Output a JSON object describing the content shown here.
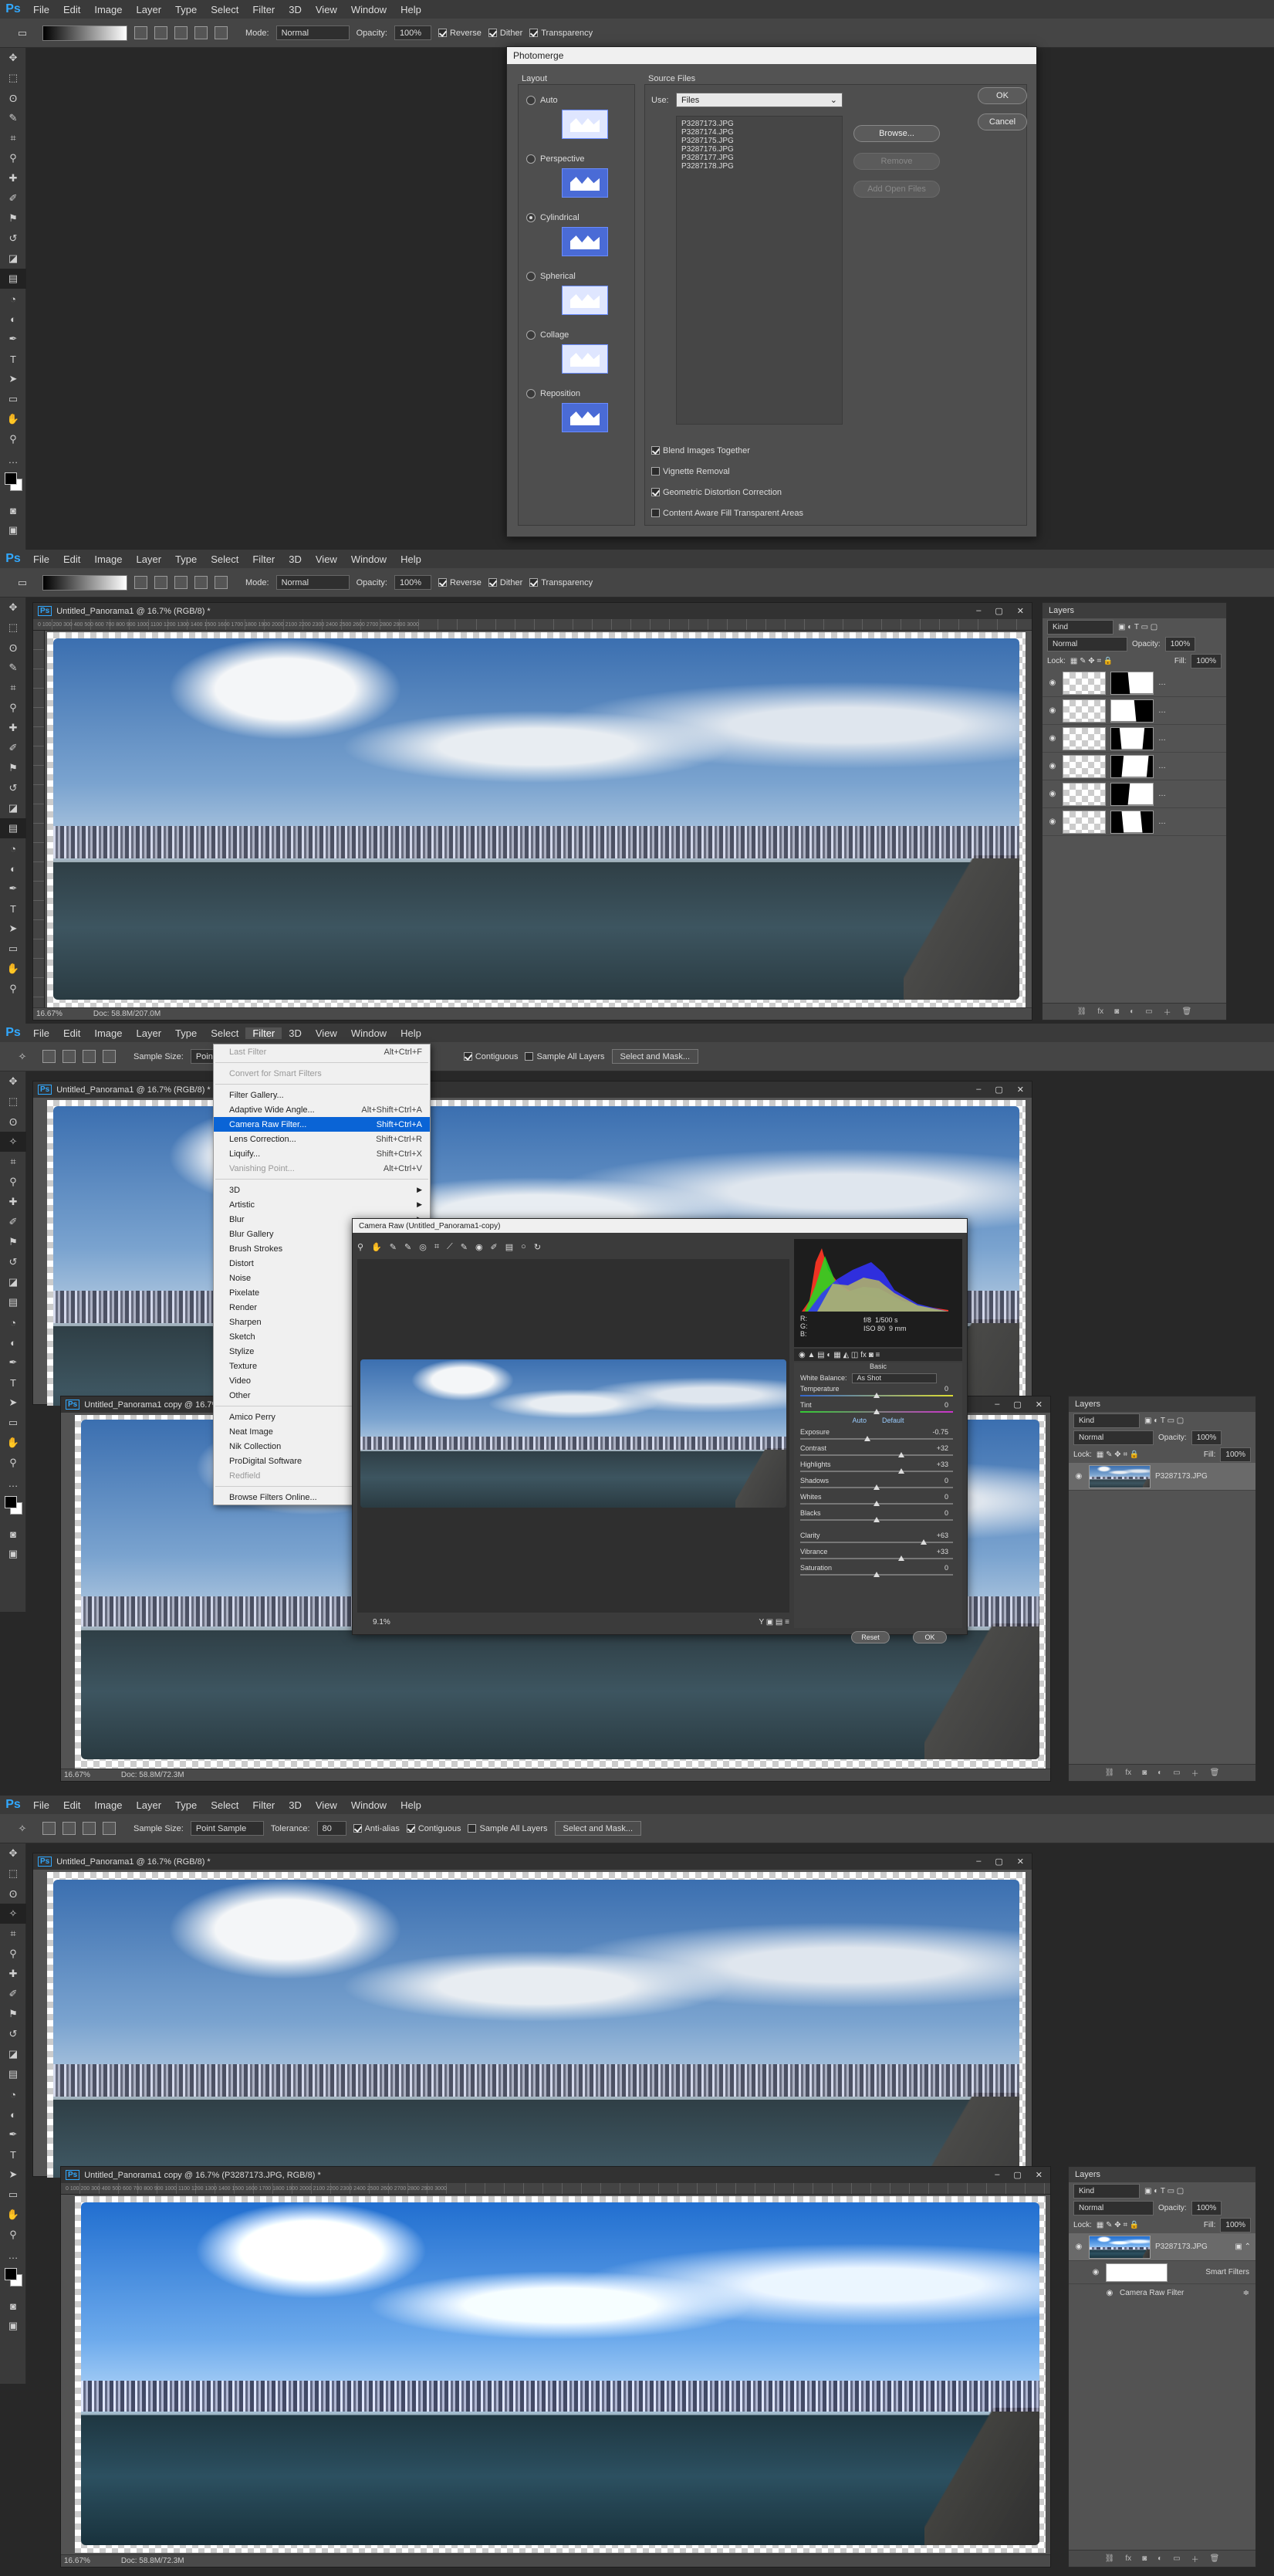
{
  "app": {
    "menus": [
      "File",
      "Edit",
      "Image",
      "Layer",
      "Type",
      "Select",
      "Filter",
      "3D",
      "View",
      "Window",
      "Help"
    ],
    "window_controls": [
      "–",
      "▢",
      "✕"
    ]
  },
  "gradient_options": {
    "mode_label": "Mode:",
    "mode_value": "Normal",
    "opacity_label": "Opacity:",
    "opacity_value": "100%",
    "reverse": "Reverse",
    "dither": "Dither",
    "transparency": "Transparency"
  },
  "wand_options": {
    "sample_size_label": "Sample Size:",
    "sample_size_value": "Point Sample",
    "tolerance_label": "Tolerance:",
    "tolerance_value": "80",
    "anti_alias": "Anti-alias",
    "contiguous": "Contiguous",
    "sample_all": "Sample All Layers",
    "select_mask": "Select and Mask..."
  },
  "photomerge": {
    "title": "Photomerge",
    "layout_label": "Layout",
    "layouts": [
      "Auto",
      "Perspective",
      "Cylindrical",
      "Spherical",
      "Collage",
      "Reposition"
    ],
    "selected_layout": "Cylindrical",
    "source_label": "Source Files",
    "use_label": "Use:",
    "use_value": "Files",
    "files": [
      "P3287173.JPG",
      "P3287174.JPG",
      "P3287175.JPG",
      "P3287176.JPG",
      "P3287177.JPG",
      "P3287178.JPG"
    ],
    "browse": "Browse...",
    "remove": "Remove",
    "add_open": "Add Open Files",
    "ok": "OK",
    "cancel": "Cancel",
    "options": [
      {
        "label": "Blend Images Together",
        "checked": true
      },
      {
        "label": "Vignette Removal",
        "checked": false
      },
      {
        "label": "Geometric Distortion Correction",
        "checked": true
      },
      {
        "label": "Content Aware Fill Transparent Areas",
        "checked": false
      }
    ]
  },
  "doc1": {
    "title": "Untitled_Panorama1 @ 16.7% (RGB/8) *",
    "zoom": "16.67%",
    "doc_size": "Doc: 58.8M/207.0M",
    "ruler": "0 100 200 300 400 500 600 700 800 900 1000 1100 1200 1300 1400 1500 1600 1700 1800 1900 2000 2100 2200 2300 2400 2500 2600 2700 2800 2900 3000"
  },
  "layers_panel": {
    "title": "Layers",
    "kind": "Kind",
    "blend": "Normal",
    "opacity_label": "Opacity:",
    "opacity": "100%",
    "lock_label": "Lock:",
    "fill_label": "Fill:",
    "fill": "100%"
  },
  "filter_menu": {
    "items": [
      {
        "label": "Last Filter",
        "shortcut": "Alt+Ctrl+F",
        "disabled": true
      },
      {
        "sep": true
      },
      {
        "label": "Convert for Smart Filters",
        "shortcut": "",
        "disabled": true
      },
      {
        "sep": true
      },
      {
        "label": "Filter Gallery...",
        "shortcut": ""
      },
      {
        "label": "Adaptive Wide Angle...",
        "shortcut": "Alt+Shift+Ctrl+A"
      },
      {
        "label": "Camera Raw Filter...",
        "shortcut": "Shift+Ctrl+A",
        "highlight": true
      },
      {
        "label": "Lens Correction...",
        "shortcut": "Shift+Ctrl+R"
      },
      {
        "label": "Liquify...",
        "shortcut": "Shift+Ctrl+X"
      },
      {
        "label": "Vanishing Point...",
        "shortcut": "Alt+Ctrl+V",
        "disabled": true
      },
      {
        "sep": true
      },
      {
        "label": "3D",
        "sub": true
      },
      {
        "label": "Artistic",
        "sub": true
      },
      {
        "label": "Blur",
        "sub": true
      },
      {
        "label": "Blur Gallery",
        "sub": true
      },
      {
        "label": "Brush Strokes",
        "sub": true
      },
      {
        "label": "Distort",
        "sub": true
      },
      {
        "label": "Noise",
        "sub": true
      },
      {
        "label": "Pixelate",
        "sub": true
      },
      {
        "label": "Render",
        "sub": true
      },
      {
        "label": "Sharpen",
        "sub": true
      },
      {
        "label": "Sketch",
        "sub": true
      },
      {
        "label": "Stylize",
        "sub": true
      },
      {
        "label": "Texture",
        "sub": true
      },
      {
        "label": "Video",
        "sub": true
      },
      {
        "label": "Other",
        "sub": true
      },
      {
        "sep": true
      },
      {
        "label": "Amico Perry",
        "shortcut": ""
      },
      {
        "label": "Neat Image",
        "shortcut": ""
      },
      {
        "label": "Nik Collection",
        "shortcut": ""
      },
      {
        "label": "ProDigital Software",
        "shortcut": ""
      },
      {
        "label": "Redfield",
        "shortcut": "",
        "disabled": true
      },
      {
        "sep": true
      },
      {
        "label": "Browse Filters Online...",
        "shortcut": ""
      }
    ]
  },
  "camera_raw": {
    "title": "Camera Raw (Untitled_Panorama1-copy)",
    "zoom": "9.1%",
    "readout_r": "R:",
    "readout_g": "G:",
    "readout_b": "B:",
    "fstop": "f/8",
    "shutter": "1/500 s",
    "iso": "ISO 80",
    "focal": "9 mm",
    "section": "Basic",
    "wb_label": "White Balance:",
    "wb_value": "As Shot",
    "auto": "Auto",
    "default": "Default",
    "sliders": [
      {
        "name": "Temperature",
        "value": "0",
        "pos": 0.5
      },
      {
        "name": "Tint",
        "value": "0",
        "pos": 0.5
      },
      {
        "name": "Exposure",
        "value": "-0.75",
        "pos": 0.44
      },
      {
        "name": "Contrast",
        "value": "+32",
        "pos": 0.66
      },
      {
        "name": "Highlights",
        "value": "+33",
        "pos": 0.66
      },
      {
        "name": "Shadows",
        "value": "0",
        "pos": 0.5
      },
      {
        "name": "Whites",
        "value": "0",
        "pos": 0.5
      },
      {
        "name": "Blacks",
        "value": "0",
        "pos": 0.5
      },
      {
        "name": "Clarity",
        "value": "+63",
        "pos": 0.81
      },
      {
        "name": "Vibrance",
        "value": "+33",
        "pos": 0.66
      },
      {
        "name": "Saturation",
        "value": "0",
        "pos": 0.5
      }
    ],
    "reset": "Reset",
    "ok": "OK"
  },
  "doc_copy": {
    "title": "Untitled_Panorama1 copy @ 16.7% (RGB/8) *",
    "zoom": "16.67%",
    "doc_size": "Doc: 58.8M/72.3M",
    "layer_name": "P3287173.JPG"
  },
  "doc_final": {
    "title": "Untitled_Panorama1 copy @ 16.7% (P3287173.JPG, RGB/8) *",
    "bg_title": "Untitled_Panorama1 @ 16.7% (RGB/8) *",
    "zoom": "16.67%",
    "doc_size": "Doc: 58.8M/72.3M",
    "layer_name": "P3287173.JPG",
    "smart_filters": "Smart Filters",
    "crf": "Camera Raw Filter"
  }
}
